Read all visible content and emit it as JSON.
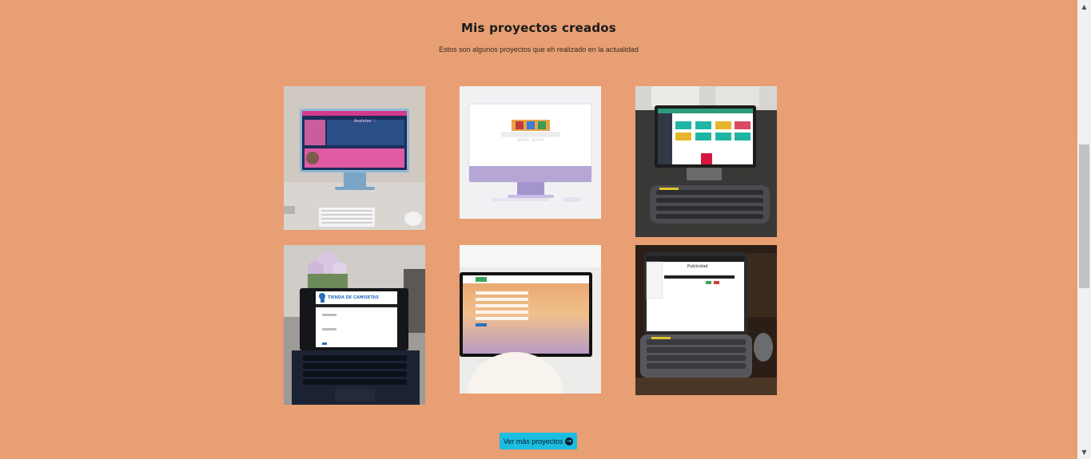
{
  "section": {
    "title": "Mis proyectos creados",
    "subtitle": "Estos son algunos proyectos que eh realizado en la actualidad"
  },
  "projects": [
    {
      "label": "Axolotes ♡"
    },
    {
      "label": ""
    },
    {
      "label": ""
    },
    {
      "label": "TIENDA DE CAMISETAS"
    },
    {
      "label": ""
    },
    {
      "label": "Publicidad"
    }
  ],
  "cta": {
    "label": "Ver más proyectos",
    "icon": "arrow-circle-right-icon"
  },
  "colors": {
    "background": "#e89f74",
    "button": "#1bbde0"
  }
}
